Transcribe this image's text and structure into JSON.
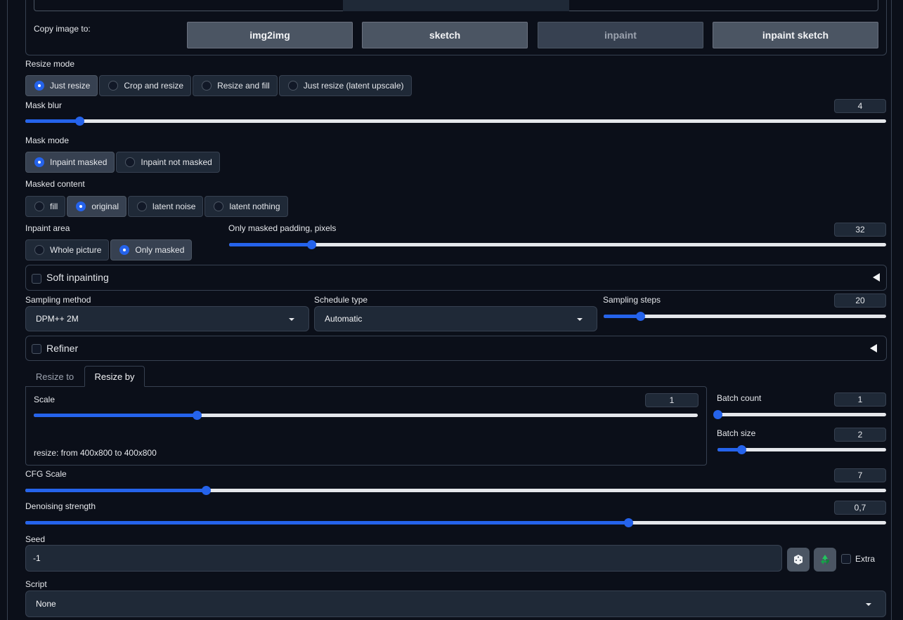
{
  "copy_image": {
    "label": "Copy image to:",
    "buttons": [
      "img2img",
      "sketch",
      "inpaint",
      "inpaint sketch"
    ]
  },
  "resize_mode": {
    "label": "Resize mode",
    "options": [
      "Just resize",
      "Crop and resize",
      "Resize and fill",
      "Just resize (latent upscale)"
    ],
    "selected": "Just resize"
  },
  "mask_blur": {
    "label": "Mask blur",
    "value": "4",
    "fraction": 0.0625
  },
  "mask_mode": {
    "label": "Mask mode",
    "options": [
      "Inpaint masked",
      "Inpaint not masked"
    ],
    "selected": "Inpaint masked"
  },
  "masked_content": {
    "label": "Masked content",
    "options": [
      "fill",
      "original",
      "latent noise",
      "latent nothing"
    ],
    "selected": "original"
  },
  "inpaint_area": {
    "label": "Inpaint area",
    "options": [
      "Whole picture",
      "Only masked"
    ],
    "selected": "Only masked"
  },
  "padding": {
    "label": "Only masked padding, pixels",
    "value": "32",
    "fraction": 0.125
  },
  "soft_inpainting": {
    "label": "Soft inpainting"
  },
  "sampling_method": {
    "label": "Sampling method",
    "value": "DPM++ 2M"
  },
  "schedule_type": {
    "label": "Schedule type",
    "value": "Automatic"
  },
  "sampling_steps": {
    "label": "Sampling steps",
    "value": "20",
    "fraction": 0.13
  },
  "refiner": {
    "label": "Refiner"
  },
  "tabs": [
    "Resize to",
    "Resize by"
  ],
  "scale": {
    "label": "Scale",
    "value": "1",
    "fraction": 0.245,
    "info": "resize: from 400x800 to 400x800"
  },
  "batch_count": {
    "label": "Batch count",
    "value": "1",
    "fraction": 0.0
  },
  "batch_size": {
    "label": "Batch size",
    "value": "2",
    "fraction": 0.14
  },
  "cfg_scale": {
    "label": "CFG Scale",
    "value": "7",
    "fraction": 0.21
  },
  "denoising": {
    "label": "Denoising strength",
    "value": "0,7",
    "fraction": 0.7
  },
  "seed": {
    "label": "Seed",
    "value": "-1",
    "extra_label": "Extra",
    "dice_icon": "dice-icon",
    "recycle_icon": "recycle-icon"
  },
  "script": {
    "label": "Script",
    "value": "None"
  },
  "colors": {
    "accent": "#2563eb",
    "background": "#0b0f19",
    "panel_border": "#374151"
  }
}
